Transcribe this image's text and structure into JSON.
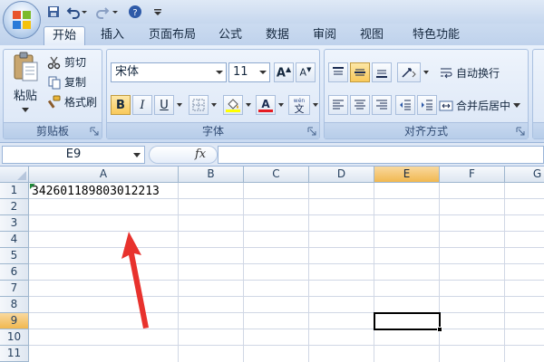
{
  "ribbon": {
    "tabs": [
      "开始",
      "插入",
      "页面布局",
      "公式",
      "数据",
      "审阅",
      "视图",
      "特色功能"
    ],
    "active_tab": "开始",
    "clipboard": {
      "paste_label": "粘贴",
      "cut_label": "剪切",
      "copy_label": "复制",
      "format_painter_label": "格式刷",
      "group_label": "剪贴板"
    },
    "font": {
      "font_name": "宋体",
      "font_size": "11",
      "bold": "B",
      "italic": "I",
      "underline": "U",
      "group_label": "字体"
    },
    "alignment": {
      "wrap_text_label": "自动换行",
      "merge_center_label": "合并后居中",
      "group_label": "对齐方式"
    }
  },
  "formula_bar": {
    "name_box": "E9",
    "fx": "fx",
    "formula": ""
  },
  "sheet": {
    "columns": [
      "A",
      "B",
      "C",
      "D",
      "E",
      "F",
      "G"
    ],
    "rows": [
      "1",
      "2",
      "3",
      "4",
      "5",
      "6",
      "7",
      "8",
      "9",
      "10",
      "11"
    ],
    "selected_column": "E",
    "selected_row": "9",
    "cell_a1": "342601189803012213"
  },
  "colors": {
    "accent": "#f1b850",
    "arrow": "#e8322d",
    "number_flag": "#1f8a3a"
  }
}
